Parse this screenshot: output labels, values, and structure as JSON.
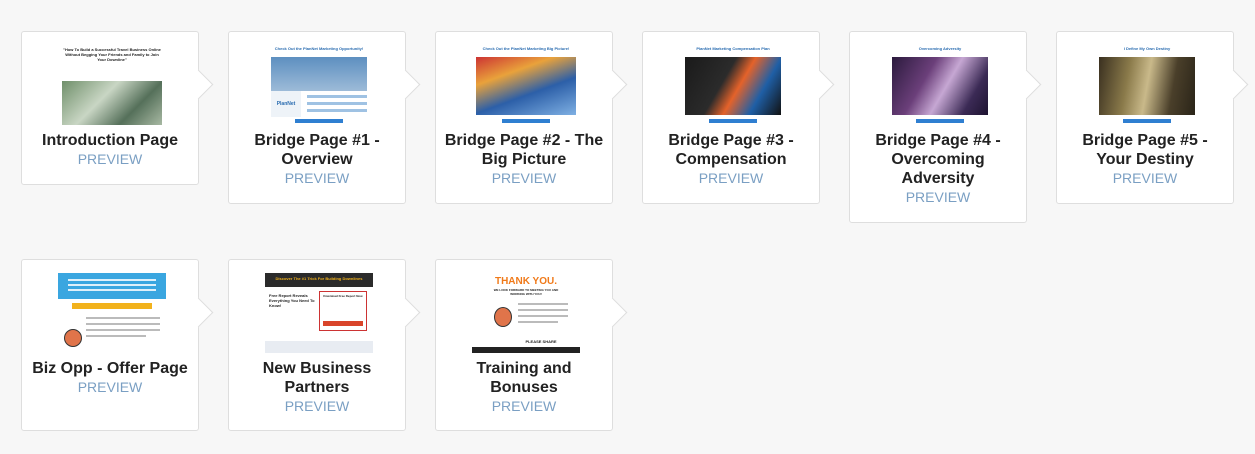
{
  "cards": [
    {
      "title": "Introduction Page",
      "preview": "PREVIEW"
    },
    {
      "title": "Bridge Page #1 - Overview",
      "preview": "PREVIEW"
    },
    {
      "title": "Bridge Page #2 - The Big Picture",
      "preview": "PREVIEW"
    },
    {
      "title": "Bridge Page #3 - Compensation",
      "preview": "PREVIEW"
    },
    {
      "title": "Bridge Page #4 - Overcoming Adversity",
      "preview": "PREVIEW"
    },
    {
      "title": "Bridge Page #5 - Your Destiny",
      "preview": "PREVIEW"
    },
    {
      "title": "Biz Opp - Offer Page",
      "preview": "PREVIEW"
    },
    {
      "title": "New Business Partners",
      "preview": "PREVIEW"
    },
    {
      "title": "Training and Bonuses",
      "preview": "PREVIEW"
    }
  ],
  "thumbs": {
    "intro_headline": "\"How To Build a Successful Travel Business Online Without Begging Your Friends and Family to Join Your Downline\"",
    "bridge1_heading": "Check Out the PlanNet Marketing Opportunity!",
    "bridge1_brand": "PlanNet",
    "bridge2_heading": "Check Out the PlanNet Marketing Big Picture!",
    "bridge3_heading": "PlanNet Marketing Compensation Plan",
    "bridge4_heading": "Overcoming Adversity",
    "bridge5_heading": "I Define My Own Destiny",
    "newbiz_banner": "Discover The #1 Trick For Building Downlines",
    "newbiz_heading": "Free Report Reveals Everything You Need To Know!",
    "newbiz_box": "Download Free Report Now",
    "training_thank": "THANK YOU.",
    "training_sub": "WE LOOK FORWARD TO MEETING YOU AND WORKING WITH YOU!",
    "training_share": "PLEASE SHARE"
  }
}
